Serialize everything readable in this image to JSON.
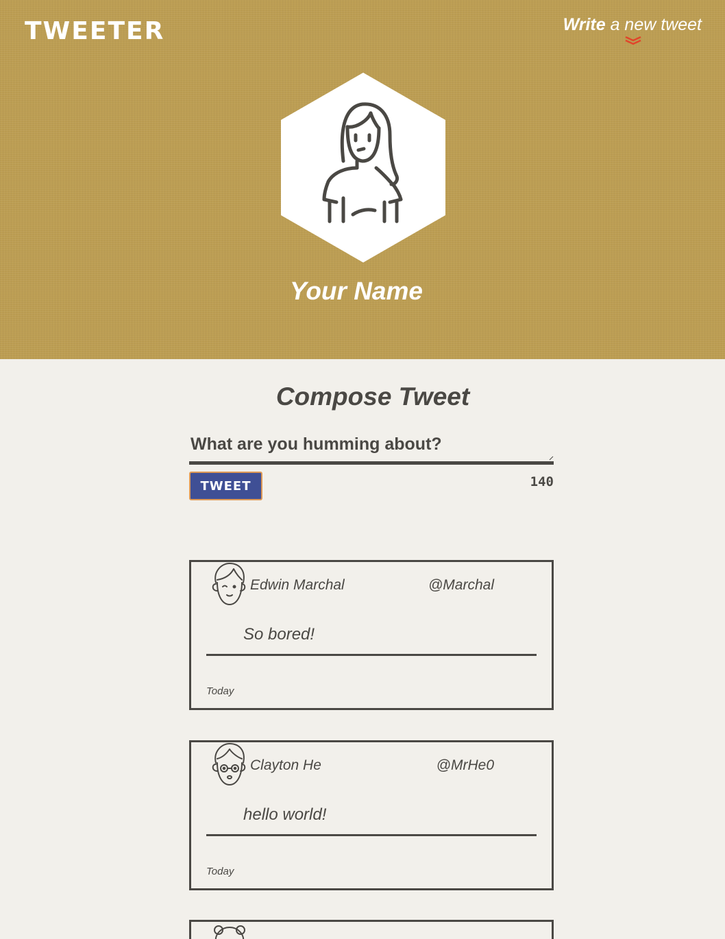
{
  "nav": {
    "brand": "TWEETER",
    "write_strong": "Write",
    "write_rest": " a new tweet",
    "chevron_icon": "double-chevron-down-icon",
    "chevron_color": "#e0452b"
  },
  "profile": {
    "avatar_icon": "user-avatar-woman-icon",
    "name": "Your Name"
  },
  "compose": {
    "title": "Compose Tweet",
    "placeholder": "What are you humming about?",
    "button_label": "TWEET",
    "counter": "140"
  },
  "tweets": [
    {
      "name": "Edwin Marchal",
      "handle": "@Marchal",
      "content": "So bored!",
      "time": "Today",
      "avatar_icon": "user-avatar-winking-man-icon"
    },
    {
      "name": "Clayton He",
      "handle": "@MrHe0",
      "content": "hello world!",
      "time": "Today",
      "avatar_icon": "user-avatar-glasses-man-icon"
    }
  ],
  "colors": {
    "header_bg": "#bc9d52",
    "page_bg": "#f2f0eb",
    "text": "#4a4844",
    "button_bg": "#3f4f95",
    "button_border": "#e09a55"
  }
}
